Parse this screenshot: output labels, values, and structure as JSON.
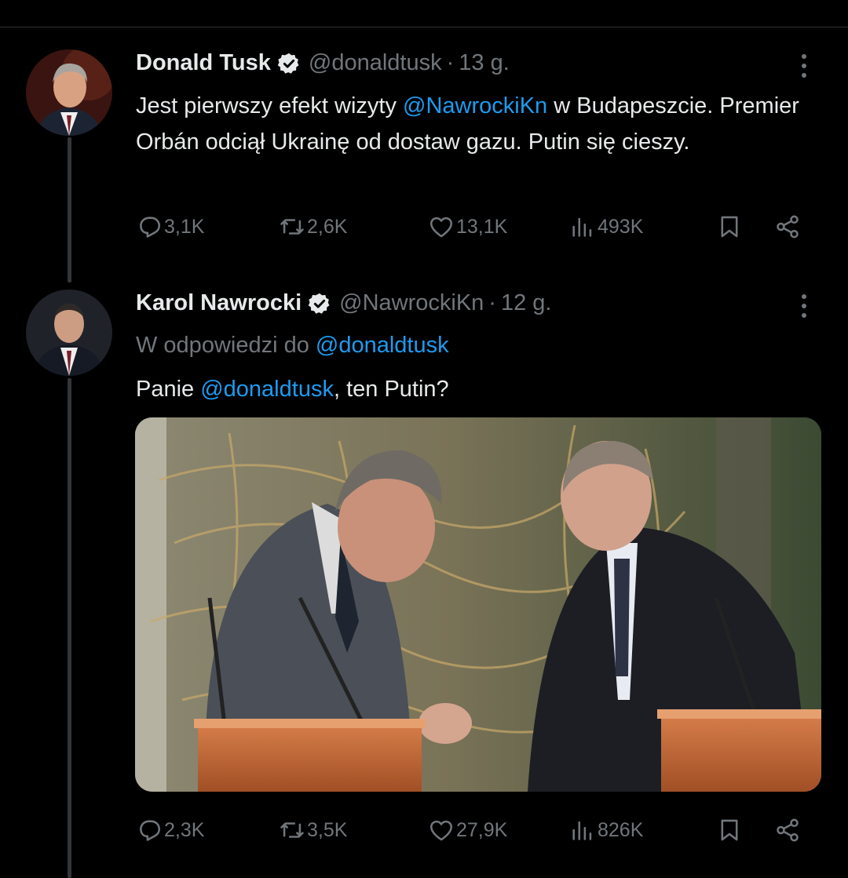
{
  "tweets": [
    {
      "name": "Donald Tusk",
      "handle": "@donaldtusk",
      "separator": "·",
      "time": "13 g.",
      "text_parts": [
        "Jest pierwszy efekt wizyty ",
        "@NawrockiKn",
        " w Budapeszcie. Premier Orbán odciął Ukrainę od dostaw gazu. Putin się cieszy."
      ],
      "stats": {
        "replies": "3,1K",
        "retweets": "2,6K",
        "likes": "13,1K",
        "views": "493K"
      }
    },
    {
      "name": "Karol Nawrocki",
      "handle": "@NawrockiKn",
      "separator": "·",
      "time": "12 g.",
      "reply_prefix": "W odpowiedzi do ",
      "reply_handle": "@donaldtusk",
      "text_parts": [
        "Panie ",
        "@donaldtusk",
        ", ten Putin?"
      ],
      "stats": {
        "replies": "2,3K",
        "retweets": "3,5K",
        "likes": "27,9K",
        "views": "826K"
      }
    }
  ],
  "icons": {
    "verified": "verified-badge-icon",
    "more": "more-icon",
    "reply": "reply-icon",
    "retweet": "retweet-icon",
    "like": "like-icon",
    "views": "views-icon",
    "bookmark": "bookmark-icon",
    "share": "share-icon"
  },
  "colors": {
    "background": "#000000",
    "text": "#e7e9ea",
    "muted": "#71767b",
    "link": "#1d9bf0"
  }
}
